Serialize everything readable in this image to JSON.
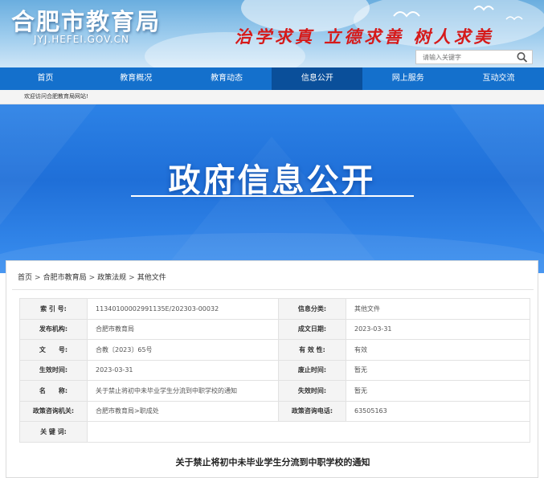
{
  "header": {
    "logo_text": "合肥市教育局",
    "domain_text": "JYJ.HEFEI.GOV.CN",
    "motto": "治学求真 立德求善 树人求美",
    "search": {
      "placeholder": "请输入关键字"
    }
  },
  "nav": {
    "items": [
      {
        "label": "首页"
      },
      {
        "label": "教育概况"
      },
      {
        "label": "教育动态"
      },
      {
        "label": "信息公开",
        "active": true
      },
      {
        "label": "网上服务"
      },
      {
        "label": "互动交流"
      }
    ]
  },
  "welcome": {
    "text": "欢迎访问合肥教育局网站!"
  },
  "hero": {
    "title": "政府信息公开"
  },
  "breadcrumb": {
    "items": [
      {
        "label": "首页"
      },
      {
        "label": "合肥市教育局"
      },
      {
        "label": "政策法规"
      },
      {
        "label": "其他文件"
      }
    ],
    "separator": ">"
  },
  "meta": {
    "rows": [
      {
        "l1": "索 引 号:",
        "v1": "11340100002991135E/202303-00032",
        "l2": "信息分类:",
        "v2": "其他文件"
      },
      {
        "l1": "发布机构:",
        "v1": "合肥市教育局",
        "l2": "成文日期:",
        "v2": "2023-03-31"
      },
      {
        "l1": "文　　号:",
        "v1": "合教〔2023〕65号",
        "l2": "有 效 性:",
        "v2": "有效"
      },
      {
        "l1": "生效时间:",
        "v1": "2023-03-31",
        "l2": "废止时间:",
        "v2": "暂无"
      },
      {
        "l1": "名　　称:",
        "v1": "关于禁止将初中未毕业学生分流到中职学校的通知",
        "l2": "失效时间:",
        "v2": "暂无"
      },
      {
        "l1": "政策咨询机关:",
        "v1": "合肥市教育局>职成处",
        "l2": "政策咨询电话:",
        "v2": "63505163"
      },
      {
        "l1": "关 键 词:",
        "v1": ""
      }
    ]
  },
  "document": {
    "title": "关于禁止将初中未毕业学生分流到中职学校的通知"
  },
  "colors": {
    "nav": "#1470cc",
    "nav_active": "#0a4f9a",
    "motto": "#d61a1a",
    "hero": "#1f6fd8"
  },
  "icons": {
    "search": "magnifier-icon"
  }
}
